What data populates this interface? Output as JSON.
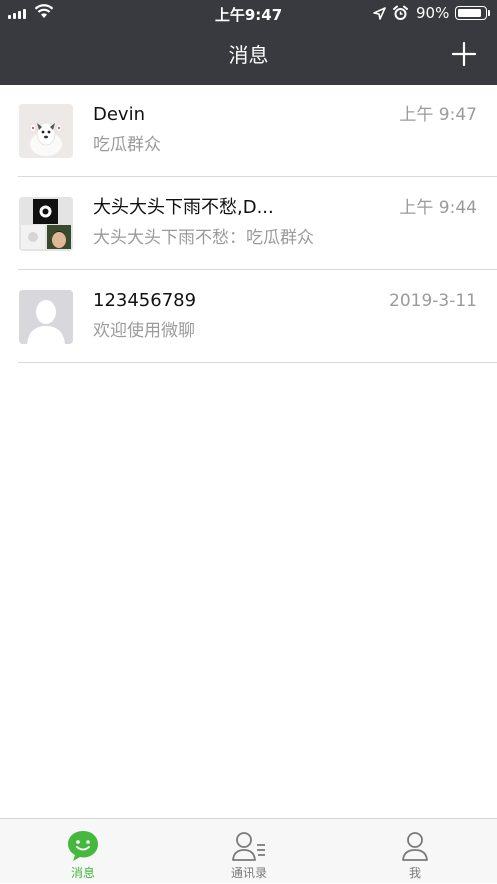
{
  "status_bar": {
    "time": "上午9:47",
    "battery": "90%",
    "battery_level": 0.9
  },
  "header": {
    "title": "消息",
    "add_icon": "plus-icon"
  },
  "conversations": [
    {
      "name": "Devin",
      "last_message": "吃瓜群众",
      "time": "上午 9:47",
      "avatar": "dog-photo-avatar"
    },
    {
      "name": "大头大头下雨不愁,D...",
      "last_message": "大头大头下雨不愁：吃瓜群众",
      "time": "上午 9:44",
      "avatar": "group-avatar"
    },
    {
      "name": "123456789",
      "last_message": "欢迎使用微聊",
      "time": "2019-3-11",
      "avatar": "default-person-avatar"
    }
  ],
  "tab_bar": {
    "active": "消息",
    "tabs": [
      {
        "label": "消息",
        "icon": "chat-bubble-icon"
      },
      {
        "label": "通讯录",
        "icon": "contacts-icon"
      },
      {
        "label": "我",
        "icon": "person-icon"
      }
    ]
  },
  "colors": {
    "header_bg": "#393a3f",
    "accent": "#46b83e",
    "secondary_text": "#9b9b9b"
  }
}
